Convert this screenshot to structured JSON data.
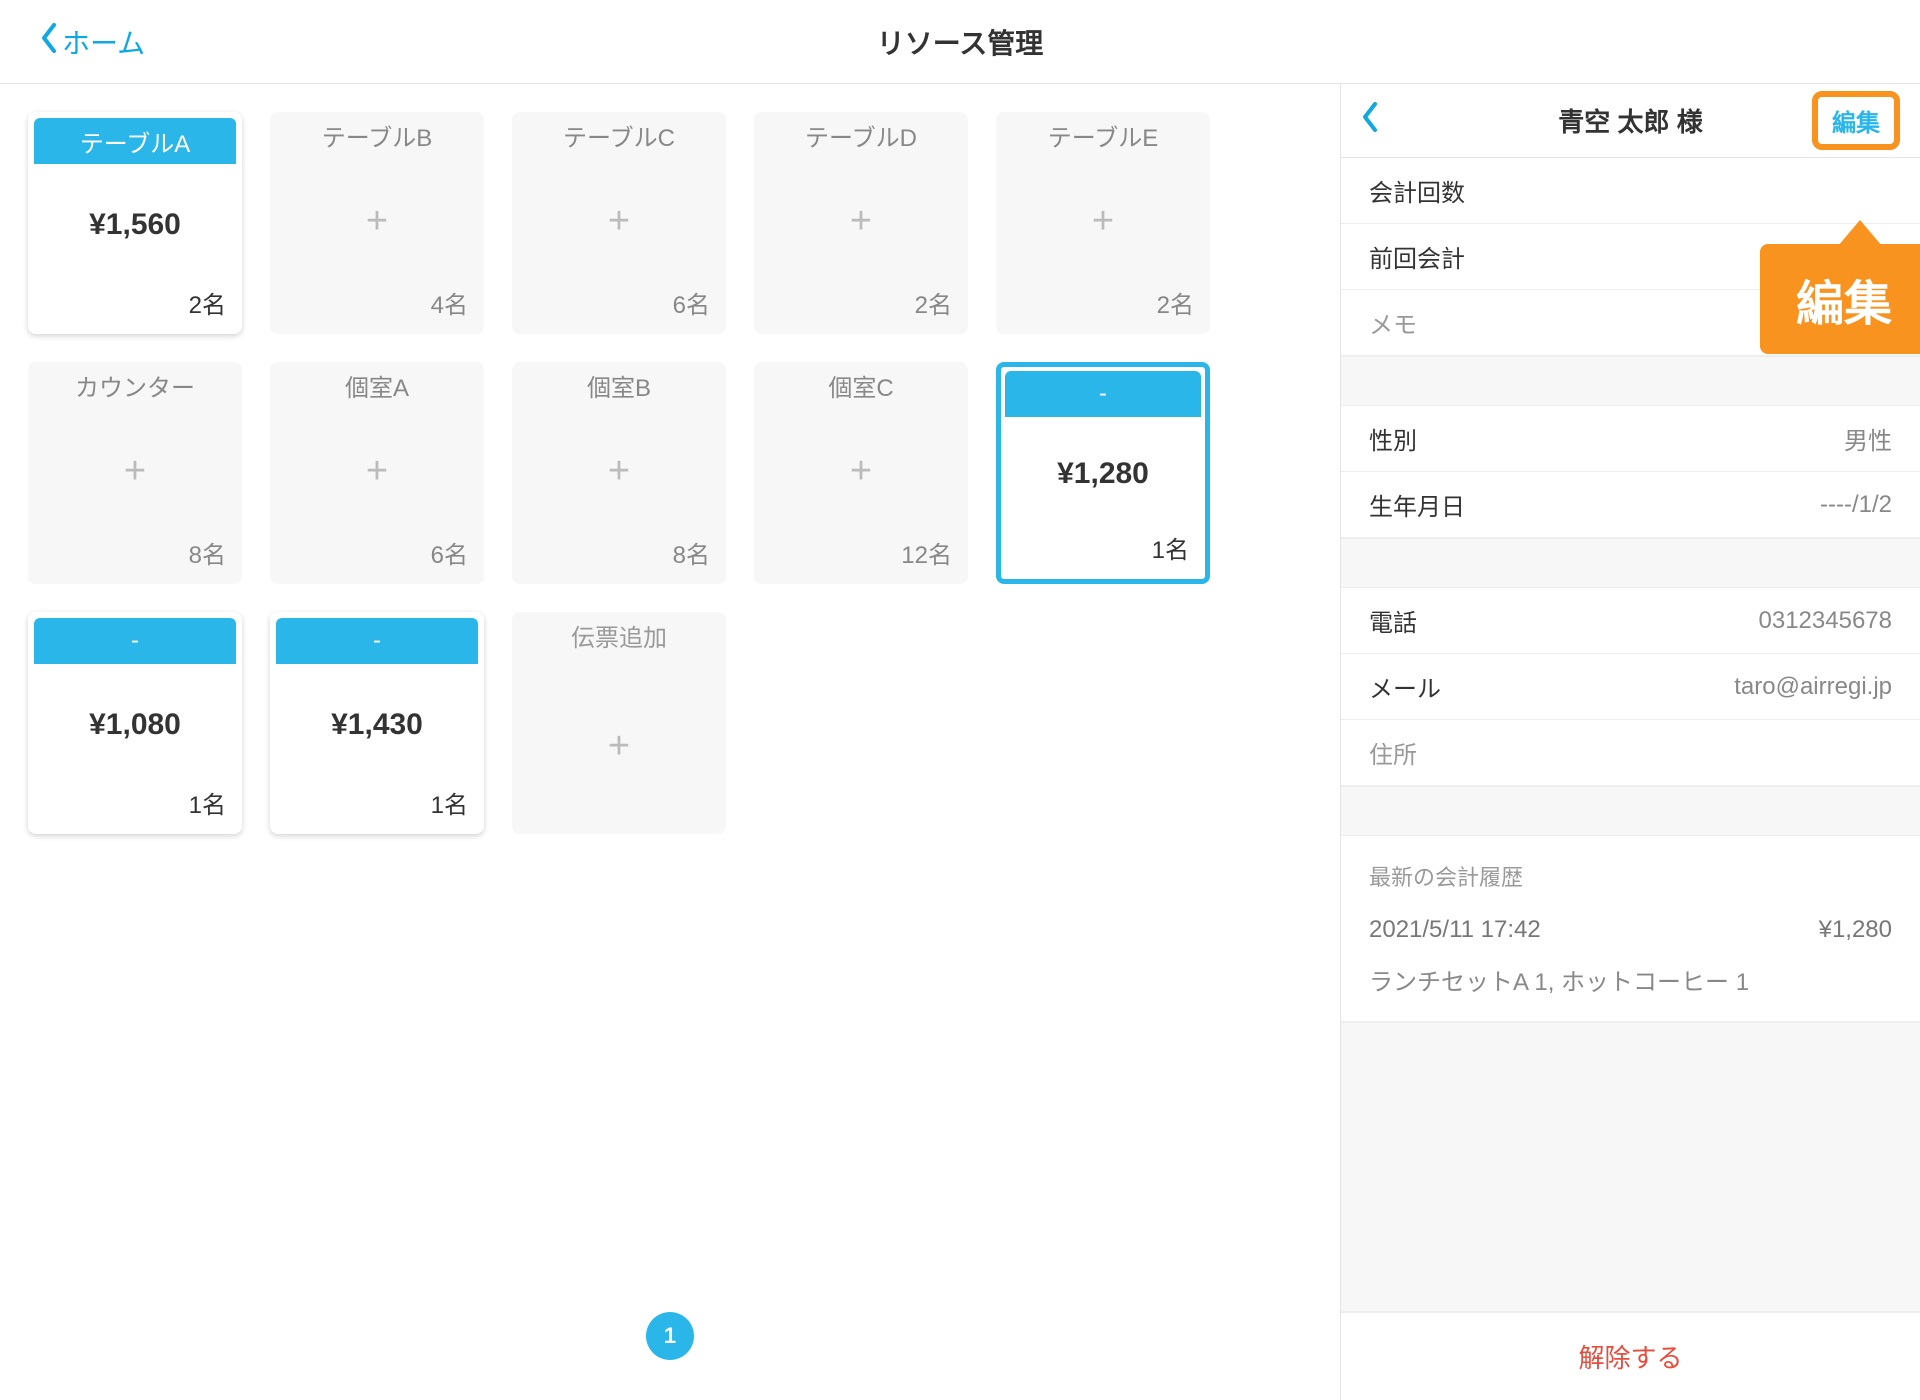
{
  "header": {
    "back_label": "ホーム",
    "title": "リソース管理"
  },
  "tables": [
    {
      "label": "テーブルA",
      "price": "¥1,560",
      "capacity": "2名",
      "kind": "occupied"
    },
    {
      "label": "テーブルB",
      "price": "",
      "capacity": "4名",
      "kind": "empty"
    },
    {
      "label": "テーブルC",
      "price": "",
      "capacity": "6名",
      "kind": "empty"
    },
    {
      "label": "テーブルD",
      "price": "",
      "capacity": "2名",
      "kind": "empty"
    },
    {
      "label": "テーブルE",
      "price": "",
      "capacity": "2名",
      "kind": "empty"
    },
    {
      "label": "カウンター",
      "price": "",
      "capacity": "8名",
      "kind": "empty"
    },
    {
      "label": "個室A",
      "price": "",
      "capacity": "6名",
      "kind": "empty"
    },
    {
      "label": "個室B",
      "price": "",
      "capacity": "8名",
      "kind": "empty"
    },
    {
      "label": "個室C",
      "price": "",
      "capacity": "12名",
      "kind": "empty"
    },
    {
      "label": "-",
      "price": "¥1,280",
      "capacity": "1名",
      "kind": "selected"
    },
    {
      "label": "-",
      "price": "¥1,080",
      "capacity": "1名",
      "kind": "occupied"
    },
    {
      "label": "-",
      "price": "¥1,430",
      "capacity": "1名",
      "kind": "occupied"
    },
    {
      "label": "伝票追加",
      "price": "",
      "capacity": "",
      "kind": "add"
    }
  ],
  "page_number": "1",
  "panel": {
    "customer_name": "青空 太郎 様",
    "edit_label": "編集",
    "row_accounting_count": "会計回数",
    "row_last_accounting": "前回会計",
    "row_memo": "メモ",
    "row_gender_label": "性別",
    "row_gender_value": "男性",
    "row_birth_label": "生年月日",
    "row_birth_value": "----/1/2",
    "row_phone_label": "電話",
    "row_phone_value": "0312345678",
    "row_email_label": "メール",
    "row_email_value": "taro@airregi.jp",
    "row_address_label": "住所",
    "history_title": "最新の会計履歴",
    "history_datetime": "2021/5/11 17:42",
    "history_amount": "¥1,280",
    "history_items": "ランチセットA 1, ホットコーヒー 1",
    "release_label": "解除する"
  },
  "callout": "編集"
}
